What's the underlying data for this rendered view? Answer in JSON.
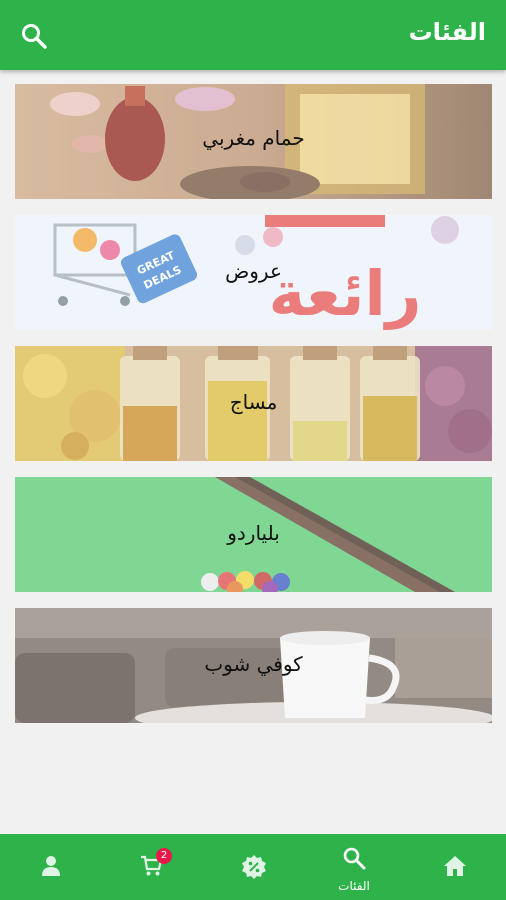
{
  "header": {
    "title": "الفئات",
    "search_icon": "search-icon"
  },
  "categories": [
    {
      "label": "حمام مغربي"
    },
    {
      "label": "عروض",
      "banner_text": "رائعة",
      "tag_text_1": "GREAT",
      "tag_text_2": "DEALS"
    },
    {
      "label": "مساج"
    },
    {
      "label": "بلياردو"
    },
    {
      "label": "كوفي شوب"
    }
  ],
  "bottom_nav": {
    "items": [
      {
        "icon": "home-icon"
      },
      {
        "icon": "search-icon",
        "label": "الفئات"
      },
      {
        "icon": "offers-badge-icon"
      },
      {
        "icon": "cart-icon",
        "badge": "2"
      },
      {
        "icon": "profile-icon"
      }
    ]
  },
  "colors": {
    "primary": "#2db34a",
    "badge": "#e8194a",
    "background": "#f1f1f1"
  }
}
